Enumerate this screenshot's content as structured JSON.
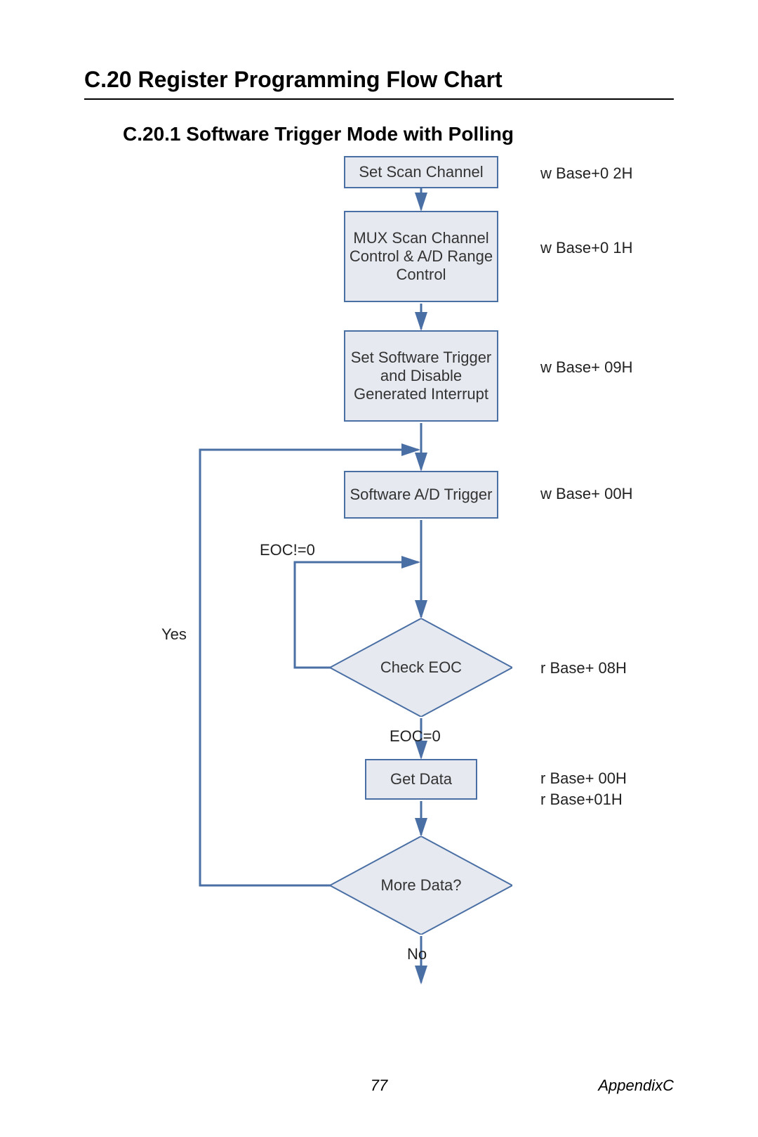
{
  "heading": "C.20  Register Programming Flow Chart",
  "subheading": "C.20.1 Software Trigger Mode with Polling",
  "boxes": {
    "b1": "Set Scan Channel",
    "b2": "MUX Scan Channel Control & A/D Range Control",
    "b3": "Set Software Trigger and Disable Generated Interrupt",
    "b4": "Software A/D Trigger",
    "b5": "Get Data"
  },
  "diamonds": {
    "d1": "Check EOC",
    "d2": "More Data?"
  },
  "annotations": {
    "a1": "w Base+0 2H",
    "a2": "w Base+0 1H",
    "a3": "w Base+ 09H",
    "a4": "w Base+ 00H",
    "a5": "r Base+ 08H",
    "a6a": "r Base+ 00H",
    "a6b": "r Base+01H"
  },
  "labels": {
    "eoc_ne": "EOC!=0",
    "eoc_eq": "EOC=0",
    "yes": "Yes",
    "no": "No"
  },
  "footer": {
    "page": "77",
    "appendix": "AppendixC"
  },
  "chart_data": {
    "type": "flowchart",
    "title": "Software Trigger Mode with Polling",
    "nodes": [
      {
        "id": "n1",
        "shape": "process",
        "label": "Set Scan Channel",
        "note": "w Base+0 2H"
      },
      {
        "id": "n2",
        "shape": "process",
        "label": "MUX Scan Channel Control & A/D Range Control",
        "note": "w Base+0 1H"
      },
      {
        "id": "n3",
        "shape": "process",
        "label": "Set Software Trigger and Disable Generated Interrupt",
        "note": "w Base+ 09H"
      },
      {
        "id": "n4",
        "shape": "process",
        "label": "Software A/D Trigger",
        "note": "w Base+ 00H"
      },
      {
        "id": "n5",
        "shape": "decision",
        "label": "Check EOC",
        "note": "r Base+ 08H"
      },
      {
        "id": "n6",
        "shape": "process",
        "label": "Get Data",
        "note": "r Base+ 00H / r Base+01H"
      },
      {
        "id": "n7",
        "shape": "decision",
        "label": "More Data?"
      }
    ],
    "edges": [
      {
        "from": "n1",
        "to": "n2"
      },
      {
        "from": "n2",
        "to": "n3"
      },
      {
        "from": "n3",
        "to": "n4"
      },
      {
        "from": "n4",
        "to": "n5"
      },
      {
        "from": "n5",
        "to": "n5",
        "label": "EOC!=0",
        "via": "loop-left-up"
      },
      {
        "from": "n5",
        "to": "n6",
        "label": "EOC=0"
      },
      {
        "from": "n6",
        "to": "n7"
      },
      {
        "from": "n7",
        "to": "n4",
        "label": "Yes",
        "via": "loop-far-left-up"
      },
      {
        "from": "n7",
        "to": "end",
        "label": "No"
      }
    ]
  }
}
